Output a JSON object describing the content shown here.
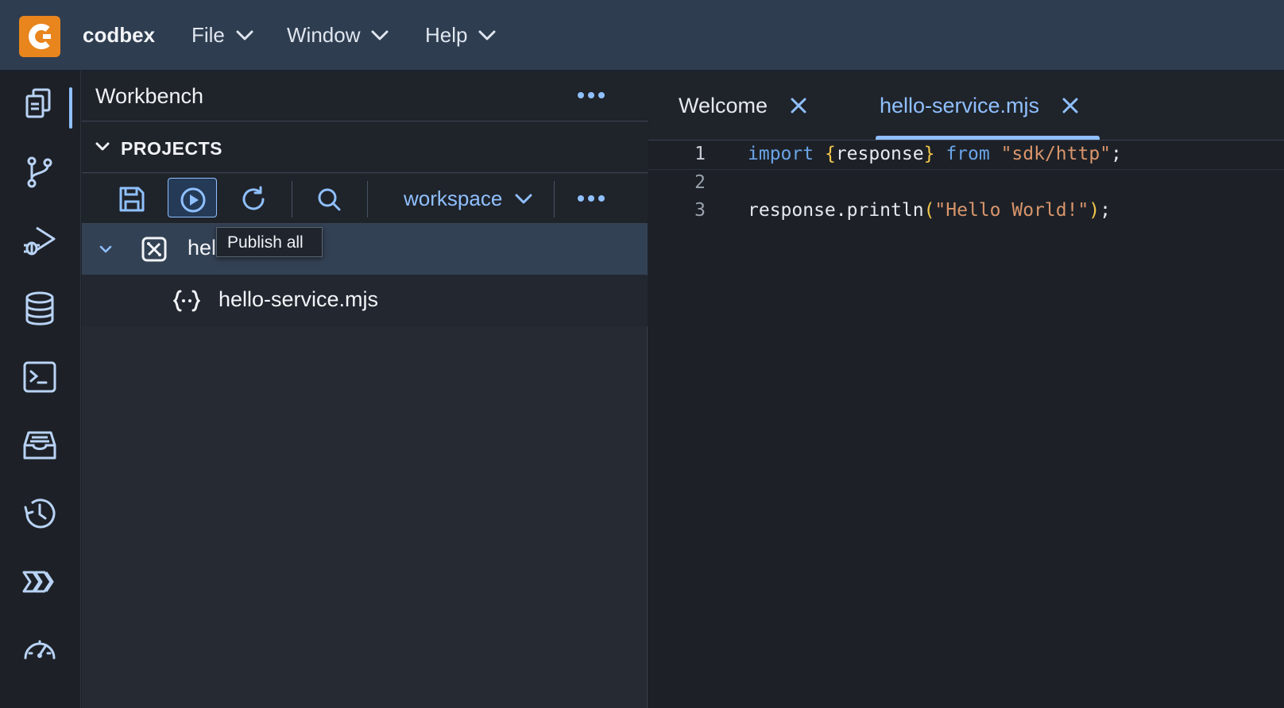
{
  "app": {
    "brand": "codbex",
    "menus": [
      {
        "label": "File"
      },
      {
        "label": "Window"
      },
      {
        "label": "Help"
      }
    ]
  },
  "activity_bar": {
    "items": [
      {
        "icon": "files-icon",
        "active": true
      },
      {
        "icon": "git-branch-icon"
      },
      {
        "icon": "debug-icon"
      },
      {
        "icon": "database-icon"
      },
      {
        "icon": "terminal-icon"
      },
      {
        "icon": "inbox-icon"
      },
      {
        "icon": "history-icon"
      },
      {
        "icon": "pipeline-icon"
      },
      {
        "icon": "speedometer-icon"
      }
    ]
  },
  "explorer": {
    "title": "Workbench",
    "section": "PROJECTS",
    "toolbar": {
      "buttons": [
        "save-icon",
        "play-icon",
        "refresh-icon",
        "search-icon"
      ],
      "workspace": "workspace"
    },
    "tree": {
      "project_label": "hel",
      "file_label": "hello-service.mjs"
    },
    "tooltip": "Publish all"
  },
  "editor": {
    "tabs": [
      {
        "label": "Welcome",
        "active": false
      },
      {
        "label": "hello-service.mjs",
        "active": true
      }
    ],
    "lines": [
      {
        "number": "1",
        "tokens": [
          {
            "t": "import",
            "c": "kw"
          },
          {
            "t": " ",
            "c": ""
          },
          {
            "t": "{",
            "c": "br"
          },
          {
            "t": "response",
            "c": ""
          },
          {
            "t": "}",
            "c": "br"
          },
          {
            "t": " ",
            "c": ""
          },
          {
            "t": "from",
            "c": "kw"
          },
          {
            "t": " ",
            "c": ""
          },
          {
            "t": "\"sdk/http\"",
            "c": "str"
          },
          {
            "t": ";",
            "c": ""
          }
        ]
      },
      {
        "number": "2",
        "tokens": []
      },
      {
        "number": "3",
        "tokens": [
          {
            "t": "response.println",
            "c": ""
          },
          {
            "t": "(",
            "c": "br"
          },
          {
            "t": "\"Hello World!\"",
            "c": "str"
          },
          {
            "t": ")",
            "c": "br"
          },
          {
            "t": ";",
            "c": ""
          }
        ]
      }
    ]
  },
  "colors": {
    "accent": "#8fc0ff",
    "brand_orange": "#e8851d",
    "topbar": "#2f3d50"
  }
}
